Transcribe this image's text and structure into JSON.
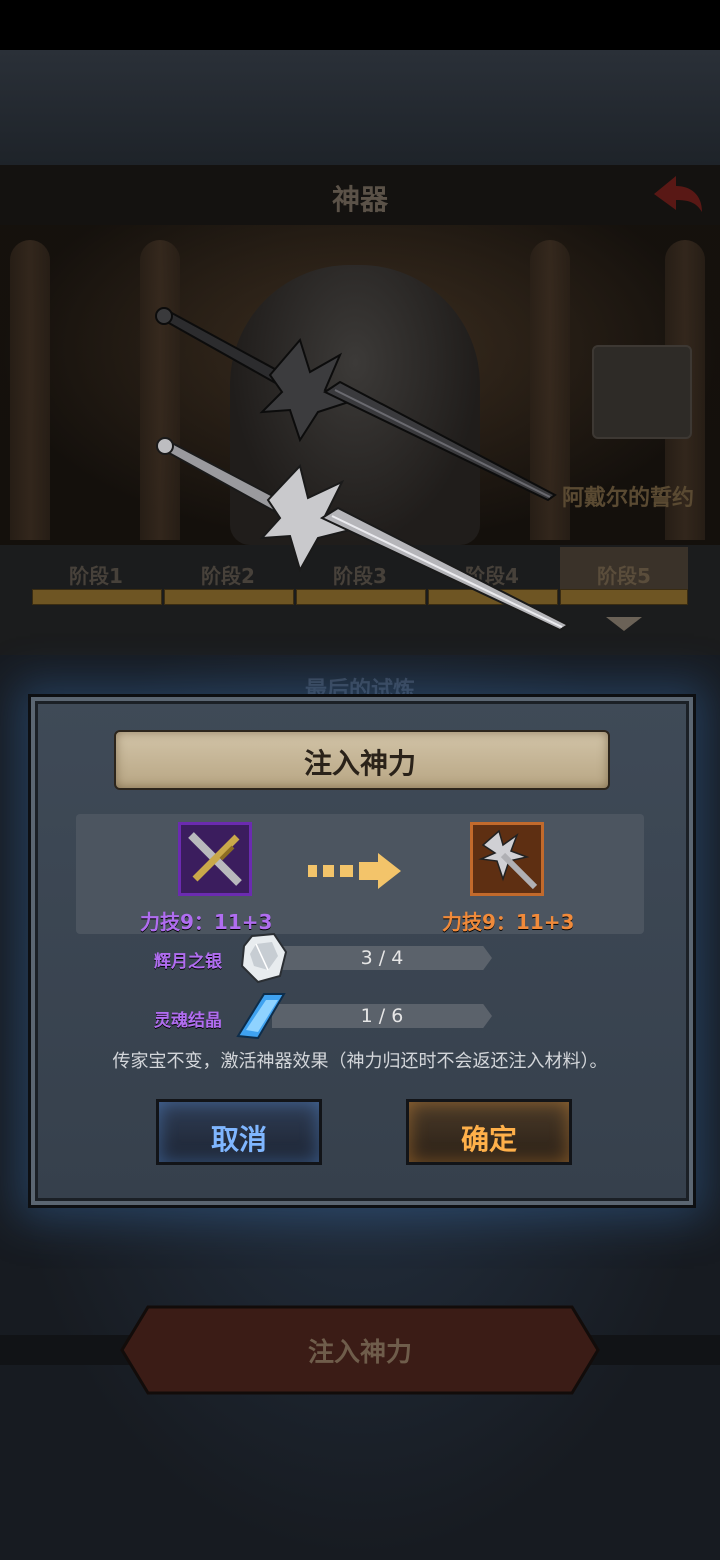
{
  "header": {
    "title": "神器"
  },
  "scene": {
    "artifact_name": "阿戴尔的誓约",
    "trial_title": "最后的试炼"
  },
  "stages": [
    "阶段1",
    "阶段2",
    "阶段3",
    "阶段4",
    "阶段5"
  ],
  "active_stage": "阶段5",
  "dialog": {
    "title": "注入神力",
    "from_stat": "力技9：11+3",
    "to_stat": "力技9：11+3",
    "materials": [
      {
        "name": "辉月之银",
        "count": "3 / 4",
        "have": 3,
        "need": 4,
        "icon": "silver-ore-icon"
      },
      {
        "name": "灵魂结晶",
        "count": "1 / 6",
        "have": 1,
        "need": 6,
        "icon": "soul-crystal-icon"
      }
    ],
    "note": "传家宝不变，激活神器效果（神力归还时不会返还注入材料）。",
    "cancel_label": "取消",
    "confirm_label": "确定"
  },
  "bottom_button": {
    "label": "注入神力"
  },
  "colors": {
    "rare_purple": "#b06df0",
    "legend_orange": "#f08a3a",
    "cancel_blue": "#7fb6ff",
    "confirm_gold": "#ffb04a"
  }
}
